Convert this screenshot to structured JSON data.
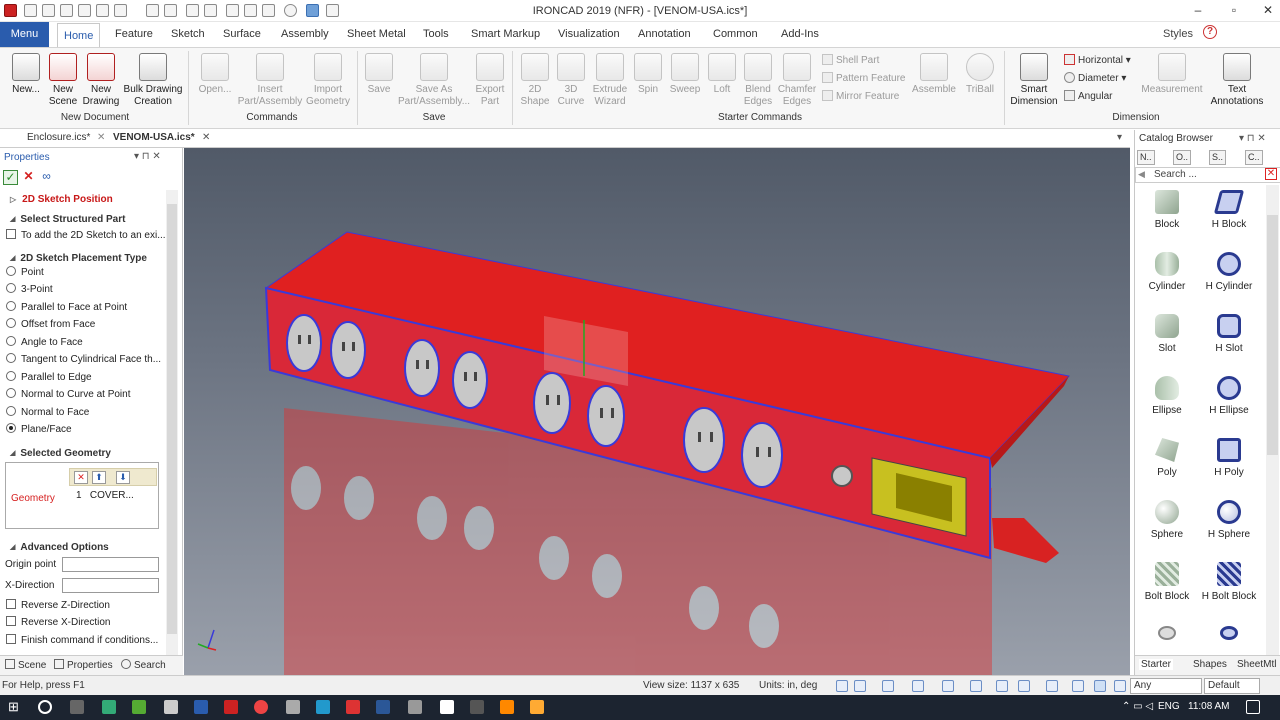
{
  "window": {
    "title": "IRONCAD 2019 (NFR) - [VENOM-USA.ics*]"
  },
  "quick_access": {
    "icons": [
      "app-logo-icon",
      "new-icon",
      "open-icon",
      "save-icon",
      "print-icon",
      "undo-icon",
      "redo-icon",
      "cursor-icon",
      "dialog-icon"
    ]
  },
  "ribbon": {
    "menu_label": "Menu",
    "tabs": [
      "Home",
      "Feature",
      "Sketch",
      "Surface",
      "Assembly",
      "Sheet Metal",
      "Tools",
      "Smart Markup",
      "Visualization",
      "Annotation",
      "Common",
      "Add-Ins"
    ],
    "active_tab": "Home",
    "styles_label": "Styles",
    "new_document": {
      "group_label": "New Document",
      "buttons": [
        {
          "l1": "New...",
          "l2": ""
        },
        {
          "l1": "New",
          "l2": "Scene"
        },
        {
          "l1": "New",
          "l2": "Drawing"
        },
        {
          "l1": "Bulk Drawing",
          "l2": "Creation"
        }
      ]
    },
    "commands": {
      "group_label": "Commands",
      "buttons": [
        {
          "l1": "Open...",
          "l2": ""
        },
        {
          "l1": "Insert",
          "l2": "Part/Assembly"
        },
        {
          "l1": "Import",
          "l2": "Geometry"
        }
      ]
    },
    "save": {
      "group_label": "Save",
      "buttons": [
        {
          "l1": "Save",
          "l2": ""
        },
        {
          "l1": "Save As",
          "l2": "Part/Assembly..."
        },
        {
          "l1": "Export",
          "l2": "Part"
        }
      ]
    },
    "starter": {
      "group_label": "Starter Commands",
      "buttons": [
        {
          "l1": "2D",
          "l2": "Shape"
        },
        {
          "l1": "3D",
          "l2": "Curve"
        },
        {
          "l1": "Extrude",
          "l2": "Wizard"
        },
        {
          "l1": "Spin",
          "l2": ""
        },
        {
          "l1": "Sweep",
          "l2": ""
        },
        {
          "l1": "Loft",
          "l2": ""
        },
        {
          "l1": "Blend",
          "l2": "Edges"
        },
        {
          "l1": "Chamfer",
          "l2": "Edges"
        }
      ],
      "small": [
        "Shell Part",
        "Pattern Feature",
        "Mirror Feature"
      ],
      "extra": [
        "Assemble",
        "TriBall"
      ]
    },
    "dimension": {
      "group_label": "Dimension",
      "smart": {
        "l1": "Smart",
        "l2": "Dimension"
      },
      "small": [
        "Horizontal",
        "Diameter",
        "Angular"
      ],
      "measurement": "Measurement",
      "text_ann": {
        "l1": "Text",
        "l2": "Annotations"
      }
    }
  },
  "doc_tabs": [
    "Enclosure.ics*",
    "VENOM-USA.ics*"
  ],
  "properties": {
    "title": "Properties",
    "heading": "2D Sketch Position",
    "select_structured": "Select Structured Part",
    "add_sketch": "To add the 2D Sketch to an exi...",
    "placement_type": "2D Sketch Placement Type",
    "placement_options": [
      "Point",
      "3-Point",
      "Parallel to Face at Point",
      "Offset from Face",
      "Angle to Face",
      "Tangent to Cylindrical Face th...",
      "Parallel to Edge",
      "Normal to Curve at Point",
      "Normal to Face",
      "Plane/Face"
    ],
    "selected_option": "Plane/Face",
    "selected_geometry": "Selected Geometry",
    "geometry_label": "Geometry",
    "geometry_items": [
      {
        "index": "1",
        "name": "COVER..."
      }
    ],
    "advanced": "Advanced Options",
    "origin_point": "Origin point",
    "x_direction": "X-Direction",
    "checks": [
      "Reverse Z-Direction",
      "Reverse X-Direction",
      "Finish command if conditions..."
    ]
  },
  "bottom_tabs": [
    "Scene",
    "Properties",
    "Search"
  ],
  "catalog": {
    "title": "Catalog Browser",
    "tabs": [
      "N..",
      "O..",
      "S..",
      "C.."
    ],
    "search_placeholder": "Search ...",
    "items": [
      "Block",
      "H Block",
      "Cylinder",
      "H Cylinder",
      "Slot",
      "H Slot",
      "Ellipse",
      "H Ellipse",
      "Poly",
      "H Poly",
      "Sphere",
      "H Sphere",
      "Bolt Block",
      "H Bolt Block"
    ],
    "bottom_tabs": [
      "Starter",
      "Shapes",
      "SheetMtl"
    ]
  },
  "status": {
    "help": "For Help, press F1",
    "view_size": "View size: 1137 x  635",
    "units": "Units: in, deg",
    "filter": "Any",
    "style": "Default"
  },
  "taskbar": {
    "lang": "ENG",
    "time": "11:08 AM"
  },
  "colors": {
    "accent": "#2a5cad",
    "part_red": "#e0201e",
    "highlight_blue": "#3a3ad8",
    "outlet_gray": "#c8c8c8",
    "inlet_yellow": "#c8c020"
  }
}
